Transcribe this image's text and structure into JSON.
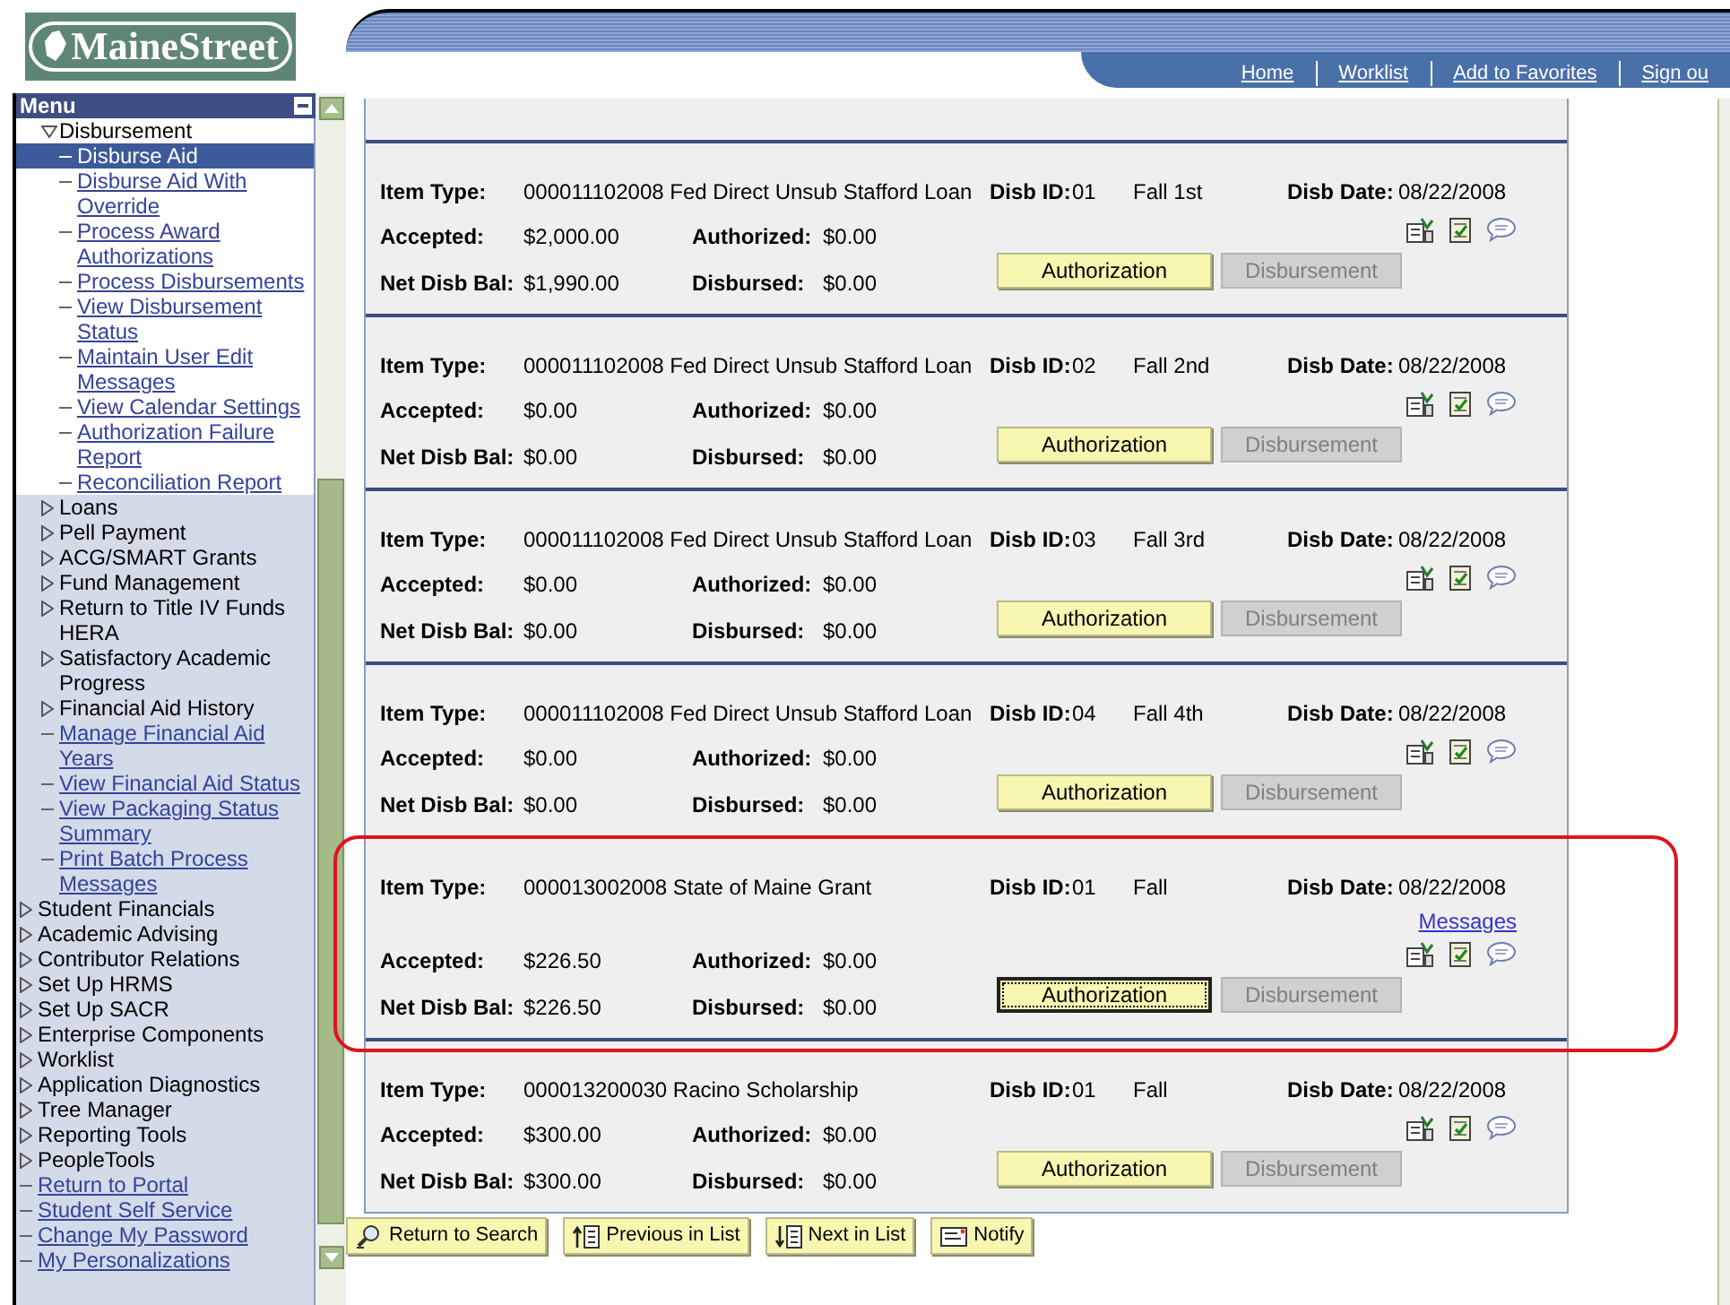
{
  "logo": "MaineStreet",
  "header_links": [
    "Home",
    "Worklist",
    "Add to Favorites",
    "Sign ou"
  ],
  "menu": {
    "title": "Menu",
    "items": [
      {
        "kind": "hidden_parent",
        "children": [
          {
            "kind": "folder",
            "label": "Disbursement",
            "expanded": true,
            "children": [
              {
                "kind": "link",
                "label": "Disburse Aid",
                "selected": true
              },
              {
                "kind": "link",
                "label": "Disburse Aid With Override",
                "selected": false
              },
              {
                "kind": "link",
                "label": "Process Award Authorizations",
                "selected": false
              },
              {
                "kind": "link",
                "label": "Process Disbursements",
                "selected": false
              },
              {
                "kind": "link",
                "label": "View Disbursement Status",
                "selected": false
              },
              {
                "kind": "link",
                "label": "Maintain User Edit Messages",
                "selected": false
              },
              {
                "kind": "link",
                "label": "View Calendar Settings",
                "selected": false
              },
              {
                "kind": "link",
                "label": "Authorization Failure Report",
                "selected": false
              },
              {
                "kind": "link",
                "label": "Reconciliation Report",
                "selected": false
              }
            ]
          },
          {
            "kind": "folder",
            "label": "Loans",
            "expanded": false
          },
          {
            "kind": "folder",
            "label": "Pell Payment",
            "expanded": false
          },
          {
            "kind": "folder",
            "label": "ACG/SMART Grants",
            "expanded": false
          },
          {
            "kind": "folder",
            "label": "Fund Management",
            "expanded": false
          },
          {
            "kind": "folder",
            "label": "Return to Title IV Funds HERA",
            "expanded": false
          },
          {
            "kind": "folder",
            "label": "Satisfactory Academic Progress",
            "expanded": false
          },
          {
            "kind": "folder",
            "label": "Financial Aid History",
            "expanded": false
          },
          {
            "kind": "link",
            "label": "Manage Financial Aid Years",
            "selected": false
          },
          {
            "kind": "link",
            "label": "View Financial Aid Status",
            "selected": false
          },
          {
            "kind": "link",
            "label": "View Packaging Status Summary",
            "selected": false
          },
          {
            "kind": "link",
            "label": "Print Batch Process Messages",
            "selected": false
          }
        ]
      },
      {
        "kind": "folder",
        "label": "Student Financials",
        "expanded": false
      },
      {
        "kind": "folder",
        "label": "Academic Advising",
        "expanded": false
      },
      {
        "kind": "folder",
        "label": "Contributor Relations",
        "expanded": false
      },
      {
        "kind": "folder",
        "label": "Set Up HRMS",
        "expanded": false
      },
      {
        "kind": "folder",
        "label": "Set Up SACR",
        "expanded": false
      },
      {
        "kind": "folder",
        "label": "Enterprise Components",
        "expanded": false
      },
      {
        "kind": "folder",
        "label": "Worklist",
        "expanded": false
      },
      {
        "kind": "folder",
        "label": "Application Diagnostics",
        "expanded": false
      },
      {
        "kind": "folder",
        "label": "Tree Manager",
        "expanded": false
      },
      {
        "kind": "folder",
        "label": "Reporting Tools",
        "expanded": false
      },
      {
        "kind": "folder",
        "label": "PeopleTools",
        "expanded": false
      },
      {
        "kind": "link",
        "label": "Return to Portal",
        "selected": false
      },
      {
        "kind": "link",
        "label": "Student Self Service",
        "selected": false
      },
      {
        "kind": "link",
        "label": "Change My Password",
        "selected": false
      },
      {
        "kind": "link",
        "label": "My Personalizations",
        "selected": false
      }
    ]
  },
  "disbursements": [
    {
      "item_type": {
        "label": "Item Type:",
        "value": "000011102008 Fed Direct Unsub Stafford Loan"
      },
      "disb_id": {
        "label": "Disb ID:",
        "value": "01"
      },
      "term": "Fall 1st",
      "disb_date": {
        "label": "Disb Date:",
        "value": "08/22/2008"
      },
      "accepted": {
        "label": "Accepted:",
        "value": "$2,000.00"
      },
      "authorized": {
        "label": "Authorized:",
        "value": "$0.00"
      },
      "net_disb_bal": {
        "label": "Net Disb Bal:",
        "value": "$1,990.00"
      },
      "disbursed": {
        "label": "Disbursed:",
        "value": "$0.00"
      },
      "buttons": [
        {
          "label": "Authorization",
          "disabled": false,
          "focused": false
        },
        {
          "label": "Disbursement",
          "disabled": true,
          "focused": false
        }
      ],
      "highlighted": false
    },
    {
      "item_type": {
        "label": "Item Type:",
        "value": "000011102008 Fed Direct Unsub Stafford Loan"
      },
      "disb_id": {
        "label": "Disb ID:",
        "value": "02"
      },
      "term": "Fall 2nd",
      "disb_date": {
        "label": "Disb Date:",
        "value": "08/22/2008"
      },
      "accepted": {
        "label": "Accepted:",
        "value": "$0.00"
      },
      "authorized": {
        "label": "Authorized:",
        "value": "$0.00"
      },
      "net_disb_bal": {
        "label": "Net Disb Bal:",
        "value": "$0.00"
      },
      "disbursed": {
        "label": "Disbursed:",
        "value": "$0.00"
      },
      "buttons": [
        {
          "label": "Authorization",
          "disabled": false,
          "focused": false
        },
        {
          "label": "Disbursement",
          "disabled": true,
          "focused": false
        }
      ],
      "highlighted": false
    },
    {
      "item_type": {
        "label": "Item Type:",
        "value": "000011102008 Fed Direct Unsub Stafford Loan"
      },
      "disb_id": {
        "label": "Disb ID:",
        "value": "03"
      },
      "term": "Fall 3rd",
      "disb_date": {
        "label": "Disb Date:",
        "value": "08/22/2008"
      },
      "accepted": {
        "label": "Accepted:",
        "value": "$0.00"
      },
      "authorized": {
        "label": "Authorized:",
        "value": "$0.00"
      },
      "net_disb_bal": {
        "label": "Net Disb Bal:",
        "value": "$0.00"
      },
      "disbursed": {
        "label": "Disbursed:",
        "value": "$0.00"
      },
      "buttons": [
        {
          "label": "Authorization",
          "disabled": false,
          "focused": false
        },
        {
          "label": "Disbursement",
          "disabled": true,
          "focused": false
        }
      ],
      "highlighted": false
    },
    {
      "item_type": {
        "label": "Item Type:",
        "value": "000011102008 Fed Direct Unsub Stafford Loan"
      },
      "disb_id": {
        "label": "Disb ID:",
        "value": "04"
      },
      "term": "Fall 4th",
      "disb_date": {
        "label": "Disb Date:",
        "value": "08/22/2008"
      },
      "accepted": {
        "label": "Accepted:",
        "value": "$0.00"
      },
      "authorized": {
        "label": "Authorized:",
        "value": "$0.00"
      },
      "net_disb_bal": {
        "label": "Net Disb Bal:",
        "value": "$0.00"
      },
      "disbursed": {
        "label": "Disbursed:",
        "value": "$0.00"
      },
      "buttons": [
        {
          "label": "Authorization",
          "disabled": false,
          "focused": false
        },
        {
          "label": "Disbursement",
          "disabled": true,
          "focused": false
        }
      ],
      "highlighted": false
    },
    {
      "item_type": {
        "label": "Item Type:",
        "value": "000013002008 State of Maine Grant"
      },
      "disb_id": {
        "label": "Disb ID:",
        "value": "01"
      },
      "term": "Fall",
      "disb_date": {
        "label": "Disb Date:",
        "value": "08/22/2008"
      },
      "messages_link": "Messages",
      "accepted": {
        "label": "Accepted:",
        "value": "$226.50"
      },
      "authorized": {
        "label": "Authorized:",
        "value": "$0.00"
      },
      "net_disb_bal": {
        "label": "Net Disb Bal:",
        "value": "$226.50"
      },
      "disbursed": {
        "label": "Disbursed:",
        "value": "$0.00"
      },
      "buttons": [
        {
          "label": "Authorization",
          "disabled": false,
          "focused": true
        },
        {
          "label": "Disbursement",
          "disabled": true,
          "focused": false
        }
      ],
      "highlighted": true
    },
    {
      "item_type": {
        "label": "Item Type:",
        "value": "000013200030 Racino Scholarship"
      },
      "disb_id": {
        "label": "Disb ID:",
        "value": "01"
      },
      "term": "Fall",
      "disb_date": {
        "label": "Disb Date:",
        "value": "08/22/2008"
      },
      "accepted": {
        "label": "Accepted:",
        "value": "$300.00"
      },
      "authorized": {
        "label": "Authorized:",
        "value": "$0.00"
      },
      "net_disb_bal": {
        "label": "Net Disb Bal:",
        "value": "$300.00"
      },
      "disbursed": {
        "label": "Disbursed:",
        "value": "$0.00"
      },
      "buttons": [
        {
          "label": "Authorization",
          "disabled": false,
          "focused": false
        },
        {
          "label": "Disbursement",
          "disabled": true,
          "focused": false
        }
      ],
      "highlighted": false
    }
  ],
  "toolbar": [
    {
      "kind": "search",
      "label": "Return to Search"
    },
    {
      "kind": "previous",
      "label": "Previous in List"
    },
    {
      "kind": "next",
      "label": "Next in List"
    },
    {
      "kind": "notify",
      "label": "Notify"
    }
  ]
}
